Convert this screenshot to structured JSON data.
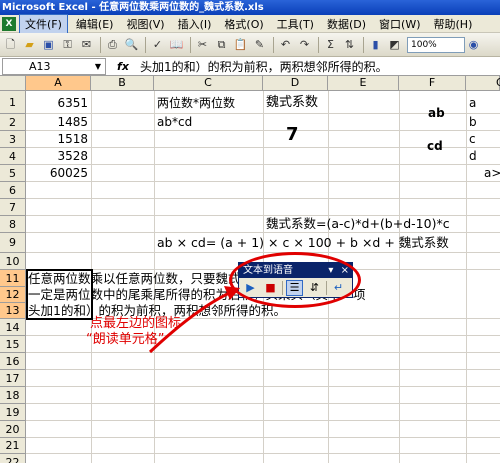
{
  "window": {
    "title": "Microsoft Excel - 任意两位数乘两位数的_魏式系数.xls"
  },
  "menu": [
    "文件(F)",
    "编辑(E)",
    "视图(V)",
    "插入(I)",
    "格式(O)",
    "工具(T)",
    "数据(D)",
    "窗口(W)",
    "帮助(H)"
  ],
  "toolbar": {
    "zoom": "100%",
    "sigma": "Σ"
  },
  "formula_bar": {
    "name_box": "A13",
    "fx": "fx",
    "content": "头加1的和）的积为前积，两积想邻所得的积。"
  },
  "columns": [
    "A",
    "B",
    "C",
    "D",
    "E",
    "F",
    "G"
  ],
  "rows": [
    "1",
    "2",
    "3",
    "4",
    "5",
    "6",
    "7",
    "8",
    "9",
    "10",
    "11",
    "12",
    "13",
    "14",
    "15",
    "16",
    "17",
    "18",
    "19",
    "20",
    "21",
    "22"
  ],
  "cells": {
    "a1": "6351",
    "a2": "1485",
    "a3": "1518",
    "a4": "3528",
    "a5": "60025",
    "c1": "两位数*两位数",
    "c2": "ab*cd",
    "d1": "魏式系数",
    "d3": "7",
    "f1": "ab",
    "f3": "cd",
    "g1": "a",
    "g2": "b",
    "g3": "c",
    "g4": "d",
    "g5": "a>",
    "d8": "魏式系数=(a-c)*d+(b+d-10)*c",
    "c9": "ab × cd= (a + 1) × c × 100 + b ×d + 魏式系数"
  },
  "merged_text": [
    "任意两位数乘以任意两位数，只要魏式系数为“0”所得的积，",
    "一定是两位数中的尾乘尾所得的积为后积，头乘头（其中一项",
    "头加1的和）的积为前积，两积想邻所得的积。"
  ],
  "tts_panel": {
    "title": "文本到语音",
    "pin": "▾",
    "close": "×"
  },
  "annotation": {
    "line1": "点最左边的图标",
    "line2": "“朗读单元格”"
  },
  "colors": {
    "title_bar": "#0a3fb8",
    "annotation": "#e00000",
    "selection_header": "#ffc88c"
  }
}
